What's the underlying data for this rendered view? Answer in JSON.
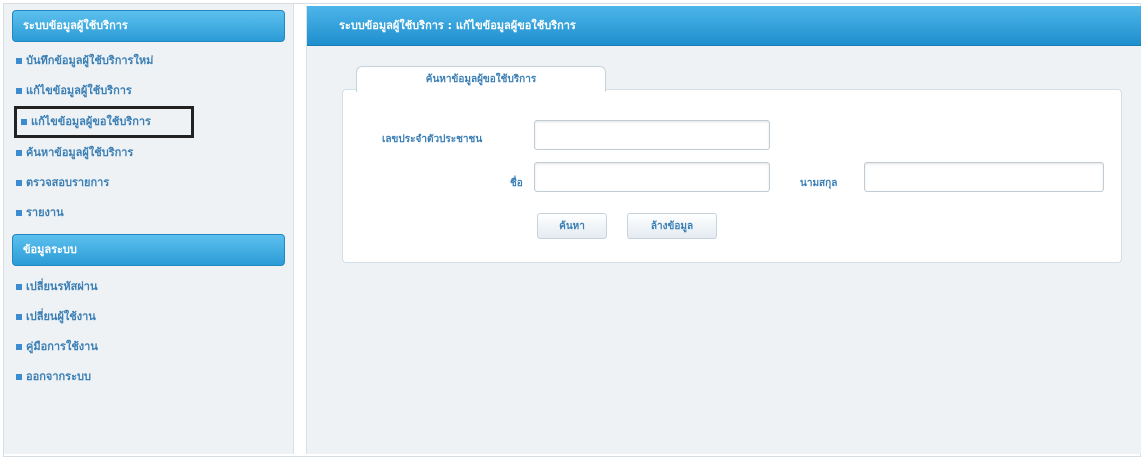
{
  "sidebar": {
    "panels": [
      {
        "title": "ระบบข้อมูลผู้ใช้บริการ",
        "items": [
          {
            "label": "บันทึกข้อมูลผู้ใช้บริการใหม่"
          },
          {
            "label": "แก้ไขข้อมูลผู้ใช้บริการ"
          },
          {
            "label": "แก้ไขข้อมูลผู้ขอใช้บริการ"
          },
          {
            "label": "ค้นหาข้อมูลผู้ใช้บริการ"
          },
          {
            "label": "ตรวจสอบรายการ"
          },
          {
            "label": "รายงาน"
          }
        ]
      },
      {
        "title": "ข้อมูลระบบ",
        "items": [
          {
            "label": "เปลี่ยนรหัสผ่าน"
          },
          {
            "label": "เปลี่ยนผู้ใช้งาน"
          },
          {
            "label": "คู่มือการใช้งาน"
          },
          {
            "label": "ออกจากระบบ"
          }
        ]
      }
    ],
    "selected_index": 2
  },
  "main": {
    "title": "ระบบข้อมูลผู้ใช้บริการ : แก้ไขข้อมูลผู้ขอใช้บริการ",
    "form_tab": "ค้นหาข้อมูลผู้ขอใช้บริการ",
    "fields": {
      "id_label": "เลขประจำตัวประชาชน",
      "id_value": "",
      "name_label": "ชื่อ",
      "name_value": "",
      "surname_label": "นามสกุล",
      "surname_value": ""
    },
    "buttons": {
      "search": "ค้นหา",
      "clear": "ล้างข้อมูล"
    }
  },
  "colors": {
    "header": "#2b9bd6",
    "text": "#3b7fb5",
    "background": "#eef2f5",
    "highlight_border": "#222222"
  }
}
